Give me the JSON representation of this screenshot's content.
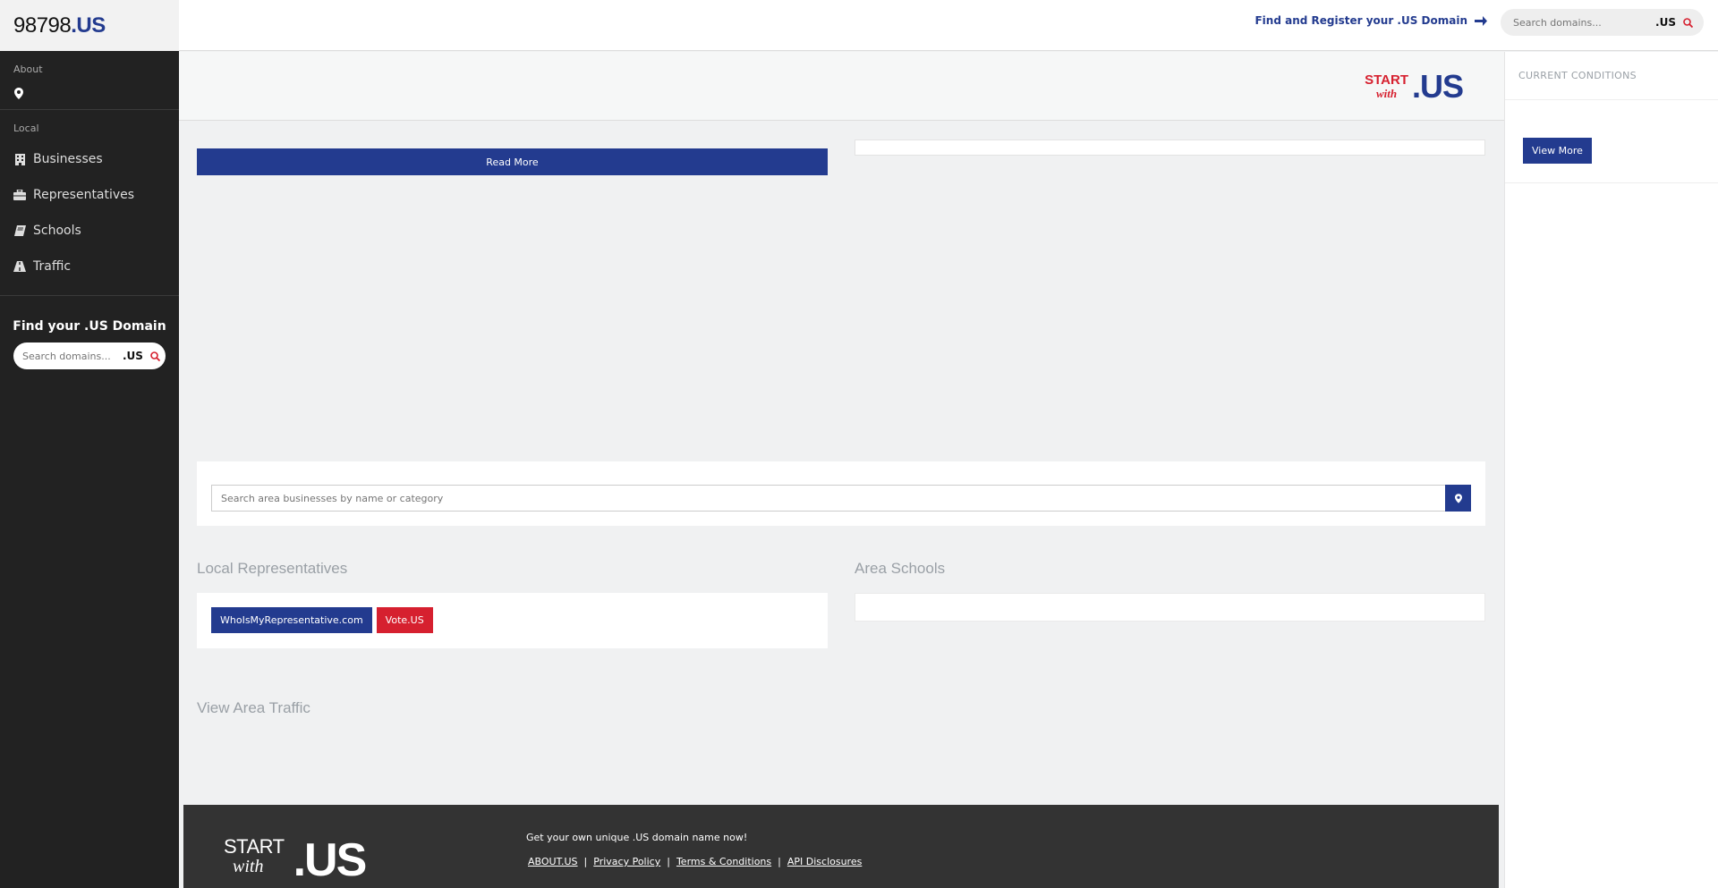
{
  "sidebar": {
    "logo": {
      "number": "98798",
      "tld": ".US"
    },
    "about_label": "About",
    "local_label": "Local",
    "items": [
      {
        "label": "Businesses",
        "icon": "building-icon"
      },
      {
        "label": "Representatives",
        "icon": "briefcase-icon"
      },
      {
        "label": "Schools",
        "icon": "book-icon"
      },
      {
        "label": "Traffic",
        "icon": "road-icon"
      }
    ],
    "find_title": "Find your .US Domain",
    "search_placeholder": "Search domains...",
    "search_tld": ".US"
  },
  "topbar": {
    "register_link": "Find and Register your .US Domain",
    "search_placeholder": "Search domains...",
    "search_tld": ".US"
  },
  "banner": {
    "brand_start": "START",
    "brand_with": "with",
    "brand_us": ".US"
  },
  "main": {
    "read_more": "Read More",
    "business_search_placeholder": "Search area businesses by name or category",
    "reps_title": "Local Representatives",
    "reps_buttons": [
      "WhoIsMyRepresentative.com",
      "Vote.US"
    ],
    "schools_title": "Area Schools",
    "traffic_title": "View Area Traffic"
  },
  "right_panel": {
    "title": "CURRENT CONDITIONS",
    "view_more": "View More"
  },
  "footer": {
    "brand_start": "START",
    "brand_with": "with",
    "brand_us": ".US",
    "tagline": "Get your own unique .US domain name now!",
    "links": [
      "ABOUT.US",
      "Privacy Policy",
      "Terms & Conditions",
      "API Disclosures"
    ]
  },
  "colors": {
    "brand_blue": "#233b8f",
    "brand_red": "#d6202f",
    "sidebar_bg": "#222222"
  }
}
